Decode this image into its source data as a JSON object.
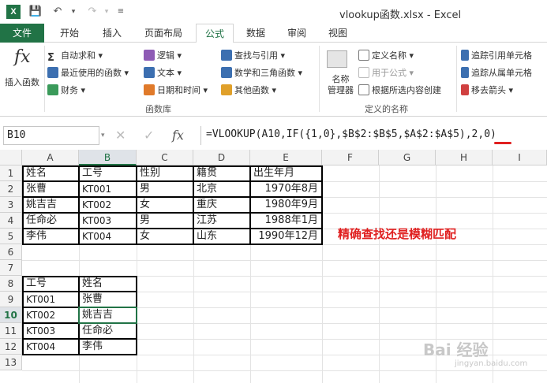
{
  "window": {
    "title": "vlookup函数.xlsx - Excel",
    "app_icon": "X"
  },
  "quick_access": [
    "save-icon",
    "undo-icon",
    "redo-icon",
    "customize-icon"
  ],
  "tabs": [
    "文件",
    "开始",
    "插入",
    "页面布局",
    "公式",
    "数据",
    "审阅",
    "视图"
  ],
  "active_tab": "公式",
  "ribbon": {
    "insert_function": "插入函数",
    "function_library": {
      "autosum": "自动求和",
      "recent": "最近使用的函数",
      "financial": "财务",
      "logical": "逻辑",
      "text": "文本",
      "datetime": "日期和时间",
      "lookup": "查找与引用",
      "math": "数学和三角函数",
      "more": "其他函数",
      "label": "函数库"
    },
    "defined_names": {
      "name_manager": "名称\n管理器",
      "name_manager_line1": "名称",
      "name_manager_line2": "管理器",
      "define_name": "定义名称",
      "use_in_formula": "用于公式",
      "create_from_selection": "根据所选内容创建",
      "label": "定义的名称"
    },
    "auditing": {
      "trace_precedents": "追踪引用单元格",
      "trace_dependents": "追踪从属单元格",
      "remove_arrows": "移去箭头"
    }
  },
  "formula_bar": {
    "name_box": "B10",
    "formula": "=VLOOKUP(A10,IF({1,0},$B$2:$B$5,$A$2:$A$5),2,0)"
  },
  "columns": [
    "A",
    "B",
    "C",
    "D",
    "E",
    "F",
    "G",
    "H",
    "I"
  ],
  "rows": [
    "1",
    "2",
    "3",
    "4",
    "5",
    "6",
    "7",
    "8",
    "9",
    "10",
    "11",
    "12",
    "13"
  ],
  "table1": {
    "headers": [
      "姓名",
      "工号",
      "性别",
      "籍贯",
      "出生年月"
    ],
    "rows": [
      [
        "张曹",
        "KT001",
        "男",
        "北京",
        "1970年8月"
      ],
      [
        "姚吉吉",
        "KT002",
        "女",
        "重庆",
        "1980年9月"
      ],
      [
        "任命必",
        "KT003",
        "男",
        "江苏",
        "1988年1月"
      ],
      [
        "李伟",
        "KT004",
        "女",
        "山东",
        "1990年12月"
      ]
    ]
  },
  "table2": {
    "headers": [
      "工号",
      "姓名"
    ],
    "rows": [
      [
        "KT001",
        "张曹"
      ],
      [
        "KT002",
        "姚吉吉"
      ],
      [
        "KT003",
        "任命必"
      ],
      [
        "KT004",
        "李伟"
      ]
    ]
  },
  "annotation": "精确查找还是模糊匹配",
  "watermark": "Bai 经验",
  "watermark_sub": "jingyan.baidu.com"
}
